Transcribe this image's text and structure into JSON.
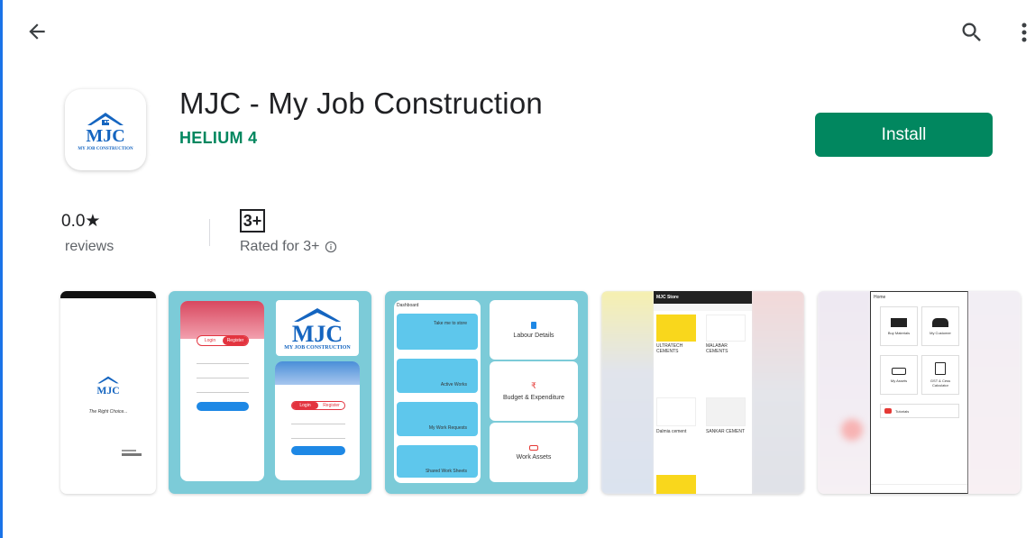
{
  "header": {
    "back_icon": "arrow-back-icon",
    "search_icon": "search-icon",
    "more_icon": "more-vert-icon"
  },
  "app": {
    "title": "MJC - My Job Construction",
    "developer": "HELIUM 4",
    "install_label": "Install",
    "icon_text": "MJC",
    "icon_subtext": "MY JOB CONSTRUCTION"
  },
  "stats": {
    "rating": "0.0★",
    "reviews_label": "reviews",
    "age_badge": "3+",
    "rated_label": "Rated for 3+",
    "info_icon": "info-icon"
  },
  "colors": {
    "accent": "#01875f",
    "screenshot_bg": "#7ccbd8"
  },
  "screenshots": {
    "s1": {
      "logo": "MJC",
      "tagline": "The Right Choice..."
    },
    "s2": {
      "logo": "MJC",
      "logo_sub": "MY JOB CONSTRUCTION",
      "login": "Login",
      "register": "Register"
    },
    "s3": {
      "dashboard": "Dashboard",
      "tiles": [
        "Take me to store",
        "Active Works",
        "My Work Requests",
        "Shared Work Sheets"
      ],
      "right_cards": [
        "Labour Details",
        "Budget & Expenditure",
        "Work Assets"
      ]
    },
    "s4": {
      "store_title": "MJC Store",
      "products": [
        "ULTRATECH CEMENTS",
        "MALABAR CEMENTS",
        "Dalmia cement",
        "SANKAR CEMENT"
      ]
    },
    "s5": {
      "home": "Home",
      "tiles": [
        "Buy Materials",
        "My Customer",
        "My Assets",
        "GST & Cess Calculator"
      ],
      "tutorials": "Tutorials"
    }
  }
}
